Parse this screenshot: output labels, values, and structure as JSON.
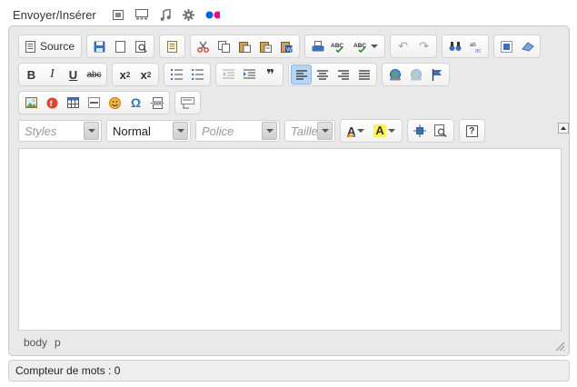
{
  "media_bar": {
    "title": "Envoyer/Insérer",
    "icons": [
      "image-icon",
      "gallery-icon",
      "music-icon",
      "gear-icon",
      "flickr-icon"
    ]
  },
  "toolbar": {
    "source_label": "Source",
    "styles_placeholder": "Styles",
    "format_value": "Normal",
    "font_placeholder": "Police",
    "size_placeholder": "Taille",
    "bold": "B",
    "italic": "I",
    "underline": "U",
    "strike": "abc",
    "subscript": "x",
    "subscript_mark": "2",
    "superscript": "x",
    "superscript_mark": "2",
    "blockquote": "❞",
    "help": "?",
    "undo": "↶",
    "redo": "↷",
    "omega": "Ω",
    "spell_label": "ABC",
    "text_color_letter": "A",
    "bg_color_letter": "A"
  },
  "colors": {
    "accent_active": "#b7d5f3",
    "frame_bg": "#e9e9e9",
    "link_icon": "#3b73b9"
  },
  "path_bar": {
    "items": [
      "body",
      "p"
    ]
  },
  "footer": {
    "word_count": "Compteur de mots : 0"
  }
}
